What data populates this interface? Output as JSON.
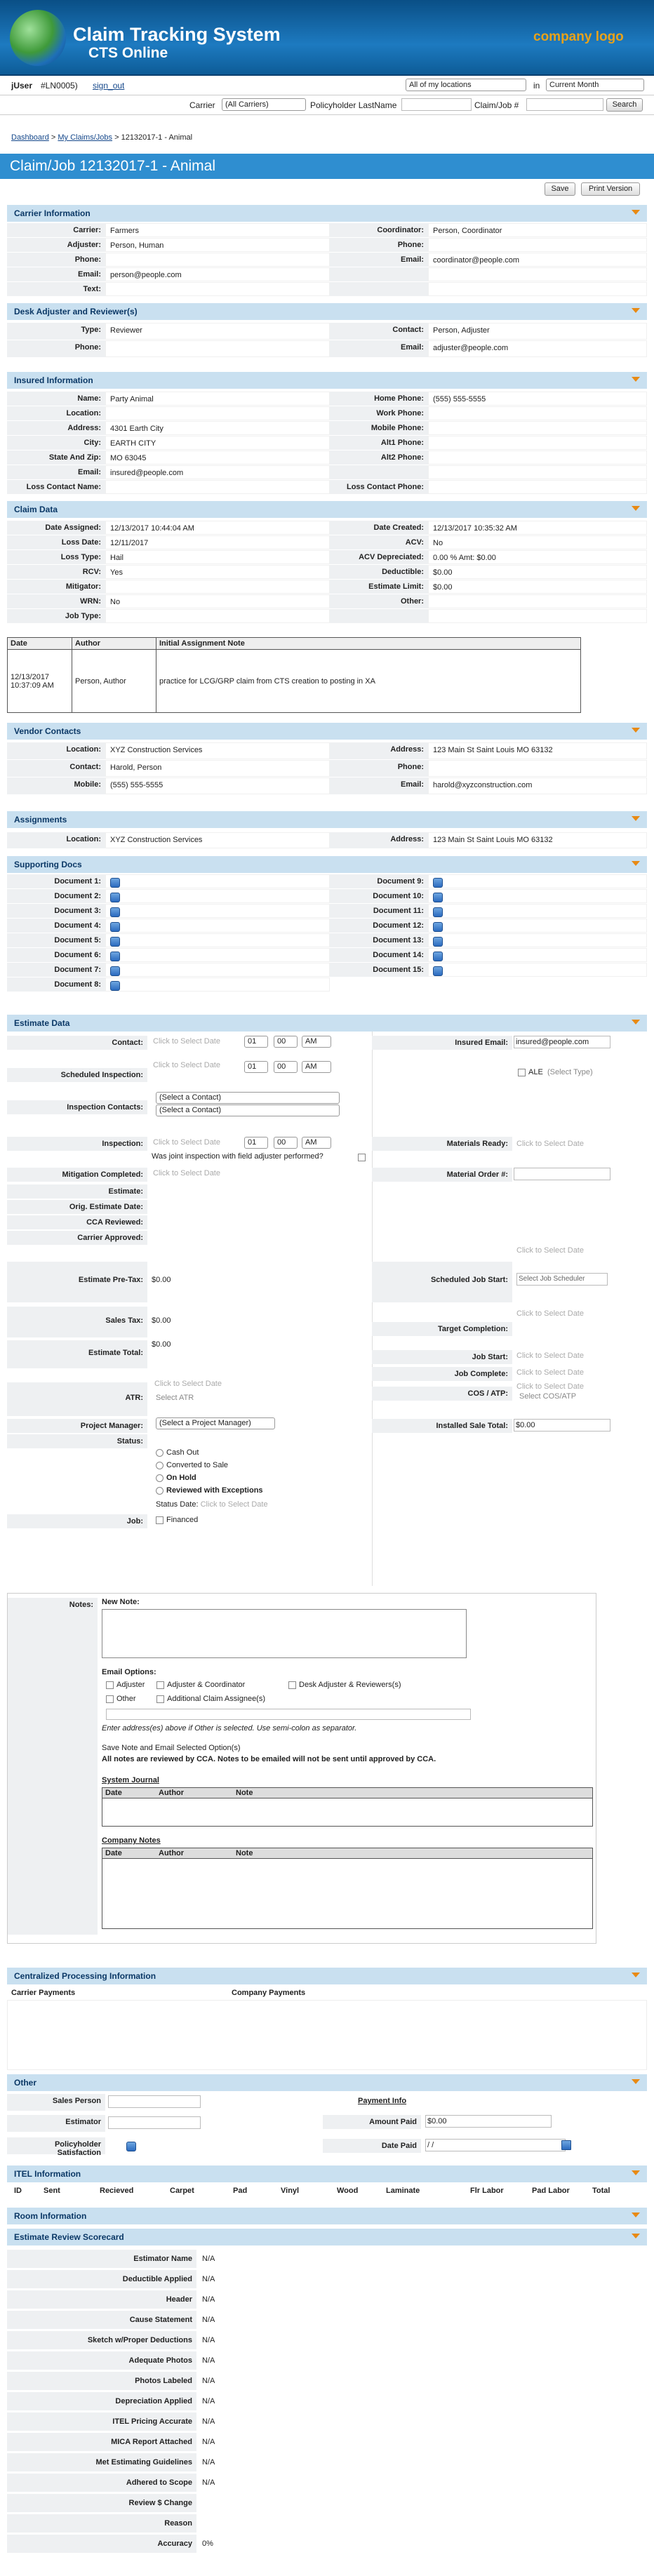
{
  "header": {
    "title": "Claim Tracking System",
    "subtitle": "CTS Online",
    "logo": "company logo"
  },
  "userbar": {
    "user": "jUser",
    "id": "#LN0005)",
    "open": "(",
    "signout": "sign_out",
    "location_select": "All of my locations",
    "in_label": "in",
    "month_select": "Current Month"
  },
  "searchbar": {
    "carrier_label": "Carrier",
    "carrier_select": "(All Carriers)",
    "policy_label": "Policyholder LastName",
    "claim_label": "Claim/Job #",
    "search_btn": "Search"
  },
  "breadcrumb": {
    "dashboard": "Dashboard",
    "myclaims": "My Claims/Jobs",
    "sep": ">",
    "current": "12132017-1 - Animal"
  },
  "page": {
    "title": "Claim/Job 12132017-1 - Animal",
    "save": "Save",
    "print": "Print Version"
  },
  "carrier": {
    "section": "Carrier Information",
    "rows": [
      {
        "l": "Carrier:",
        "v": "Farmers",
        "l2": "Coordinator:",
        "v2": "Person, Coordinator"
      },
      {
        "l": "Adjuster:",
        "v": "Person, Human",
        "l2": "Phone:",
        "v2": ""
      },
      {
        "l": "Phone:",
        "v": "",
        "l2": "Email:",
        "v2": "coordinator@people.com"
      },
      {
        "l": "Email:",
        "v": "person@people.com",
        "l2": "",
        "v2": ""
      },
      {
        "l": "Text:",
        "v": "",
        "l2": "",
        "v2": ""
      }
    ]
  },
  "desk": {
    "section": "Desk Adjuster and Reviewer(s)",
    "rows": [
      {
        "l": "Type:",
        "v": "Reviewer",
        "l2": "Contact:",
        "v2": "Person, Adjuster"
      },
      {
        "l": "Phone:",
        "v": "",
        "l2": "Email:",
        "v2": "adjuster@people.com"
      }
    ]
  },
  "insured": {
    "section": "Insured Information",
    "rows": [
      {
        "l": "Name:",
        "v": "Party Animal",
        "l2": "Home Phone:",
        "v2": "(555) 555-5555"
      },
      {
        "l": "Location:",
        "v": "",
        "l2": "Work Phone:",
        "v2": ""
      },
      {
        "l": "Address:",
        "v": "4301 Earth City",
        "l2": "Mobile Phone:",
        "v2": ""
      },
      {
        "l": "City:",
        "v": "EARTH CITY",
        "l2": "Alt1 Phone:",
        "v2": ""
      },
      {
        "l": "State And Zip:",
        "v": "MO 63045",
        "l2": "Alt2 Phone:",
        "v2": ""
      },
      {
        "l": "Email:",
        "v": "insured@people.com",
        "l2": "",
        "v2": ""
      },
      {
        "l": "Loss Contact Name:",
        "v": "",
        "l2": "Loss Contact Phone:",
        "v2": ""
      }
    ]
  },
  "claim": {
    "section": "Claim Data",
    "rows": [
      {
        "l": "Date Assigned:",
        "v": "12/13/2017 10:44:04 AM",
        "l2": "Date Created:",
        "v2": "12/13/2017 10:35:32 AM"
      },
      {
        "l": "Loss Date:",
        "v": "12/11/2017",
        "l2": "ACV:",
        "v2": "No"
      },
      {
        "l": "Loss Type:",
        "v": "Hail",
        "l2": "ACV Depreciated:",
        "v2": "0.00 %  Amt: $0.00"
      },
      {
        "l": "RCV:",
        "v": "Yes",
        "l2": "Deductible:",
        "v2": "$0.00"
      },
      {
        "l": "Mitigator:",
        "v": "",
        "l2": "Estimate Limit:",
        "v2": "$0.00"
      },
      {
        "l": "WRN:",
        "v": "No",
        "l2": "Other:",
        "v2": ""
      },
      {
        "l": "Job Type:",
        "v": "",
        "l2": "",
        "v2": ""
      }
    ]
  },
  "notes_table": {
    "h_date": "Date",
    "h_author": "Author",
    "h_note": "Initial Assignment Note",
    "date": "12/13/2017 10:37:09 AM",
    "author": "Person, Author",
    "note": "practice for LCG/GRP claim from CTS creation to posting in XA"
  },
  "vendor": {
    "section": "Vendor Contacts",
    "rows": [
      {
        "l": "Location:",
        "v": "XYZ Construction Services",
        "l2": "Address:",
        "v2": "123 Main St Saint Louis MO 63132"
      },
      {
        "l": "Contact:",
        "v": "Harold, Person",
        "l2": "Phone:",
        "v2": ""
      },
      {
        "l": "Mobile:",
        "v": "(555) 555-5555",
        "l2": "Email:",
        "v2": "harold@xyzconstruction.com"
      }
    ]
  },
  "assign": {
    "section": "Assignments",
    "rows": [
      {
        "l": "Location:",
        "v": "XYZ Construction Services",
        "l2": "Address:",
        "v2": "123 Main St Saint Louis MO 63132"
      }
    ]
  },
  "docs": {
    "section": "Supporting Docs",
    "left": [
      "Document 1:",
      "Document 2:",
      "Document 3:",
      "Document 4:",
      "Document 5:",
      "Document 6:",
      "Document 7:",
      "Document 8:"
    ],
    "right": [
      "Document 9:",
      "Document 10:",
      "Document 11:",
      "Document 12:",
      "Document 13:",
      "Document 14:",
      "Document 15:"
    ]
  },
  "estimate": {
    "section": "Estimate Data",
    "contact": "Contact:",
    "click": "Click to Select Date",
    "hr": "01",
    "min": "00",
    "ampm": "AM",
    "insured_email": "Insured Email:",
    "insured_email_v": "insured@people.com",
    "sched": "Scheduled Inspection:",
    "ale": "ALE",
    "select_type": "(Select Type)",
    "insp_contacts": "Inspection Contacts:",
    "select_contact": "(Select a Contact)",
    "inspection": "Inspection:",
    "materials": "Materials Ready:",
    "joint": "Was joint inspection with field adjuster performed?",
    "mitig": "Mitigation Completed:",
    "mat_order": "Material Order #:",
    "estimate": "Estimate:",
    "orig": "Orig. Estimate Date:",
    "cca": "CCA Reviewed:",
    "carrier_app": "Carrier Approved:",
    "pretax": "Estimate Pre-Tax:",
    "pretax_v": "$0.00",
    "sched_start": "Scheduled Job Start:",
    "job_sched": "Select Job Scheduler",
    "sales": "Sales Tax:",
    "sales_v": "$0.00",
    "target": "Target Completion:",
    "total": "Estimate Total:",
    "total_v": "$0.00",
    "jobstart": "Job Start:",
    "jobcomplete": "Job Complete:",
    "atr": "ATR:",
    "select_atr": "Select ATR",
    "cos": "COS / ATP:",
    "select_cos": "Select COS/ATP",
    "pm": "Project Manager:",
    "select_pm": "(Select a Project Manager)",
    "installed": "Installed Sale Total:",
    "installed_v": "$0.00",
    "status": "Status:",
    "st1": "Cash Out",
    "st2": "Converted to Sale",
    "st3": "On Hold",
    "st4": "Reviewed with Exceptions",
    "status_date": "Status Date:",
    "job": "Job:",
    "financed": "Financed"
  },
  "notesarea": {
    "notes": "Notes:",
    "new_note": "New Note:",
    "email_opts": "Email Options:",
    "o1": "Adjuster",
    "o2": "Adjuster & Coordinator",
    "o3": "Desk Adjuster & Reviewers(s)",
    "o4": "Other",
    "o5": "Additional Claim Assignee(s)",
    "hint": "Enter address(es) above if Other is selected. Use semi-colon as separator.",
    "save_note": "Save Note and Email Selected Option(s)",
    "review": "All notes are reviewed by CCA. Notes to be emailed will not be sent until approved by CCA.",
    "journal": "System Journal",
    "company": "Company Notes",
    "h_date": "Date",
    "h_author": "Author",
    "h_note": "Note"
  },
  "cpi": {
    "section": "Centralized Processing Information",
    "carrier_pay": "Carrier Payments",
    "company_pay": "Company Payments"
  },
  "other": {
    "section": "Other",
    "sales": "Sales Person",
    "payment": "Payment Info",
    "estimator": "Estimator",
    "amount": "Amount Paid",
    "amount_v": "$0.00",
    "satisfaction": "Policyholder Satisfaction",
    "date_paid": "Date Paid",
    "date_v": " / /"
  },
  "itel": {
    "section": "ITEL Information",
    "cols": [
      "ID",
      "Sent",
      "Recieved",
      "Carpet",
      "Pad",
      "Vinyl",
      "Wood",
      "Laminate",
      "Flr Labor",
      "Pad Labor",
      "Total"
    ]
  },
  "room": {
    "section": "Room Information"
  },
  "scorecard": {
    "section": "Estimate Review Scorecard",
    "rows": [
      {
        "l": "Estimator Name",
        "v": "N/A"
      },
      {
        "l": "Deductible Applied",
        "v": "N/A"
      },
      {
        "l": "Header",
        "v": "N/A"
      },
      {
        "l": "Cause Statement",
        "v": "N/A"
      },
      {
        "l": "Sketch w/Proper Deductions",
        "v": "N/A"
      },
      {
        "l": "Adequate Photos",
        "v": "N/A"
      },
      {
        "l": "Photos Labeled",
        "v": "N/A"
      },
      {
        "l": "Depreciation Applied",
        "v": "N/A"
      },
      {
        "l": "ITEL Pricing Accurate",
        "v": "N/A"
      },
      {
        "l": "MICA Report Attached",
        "v": "N/A"
      },
      {
        "l": "Met Estimating Guidelines",
        "v": "N/A"
      },
      {
        "l": "Adhered to Scope",
        "v": "N/A"
      },
      {
        "l": "Review $ Change",
        "v": ""
      },
      {
        "l": "Reason",
        "v": ""
      },
      {
        "l": "Accuracy",
        "v": "0%"
      }
    ]
  }
}
